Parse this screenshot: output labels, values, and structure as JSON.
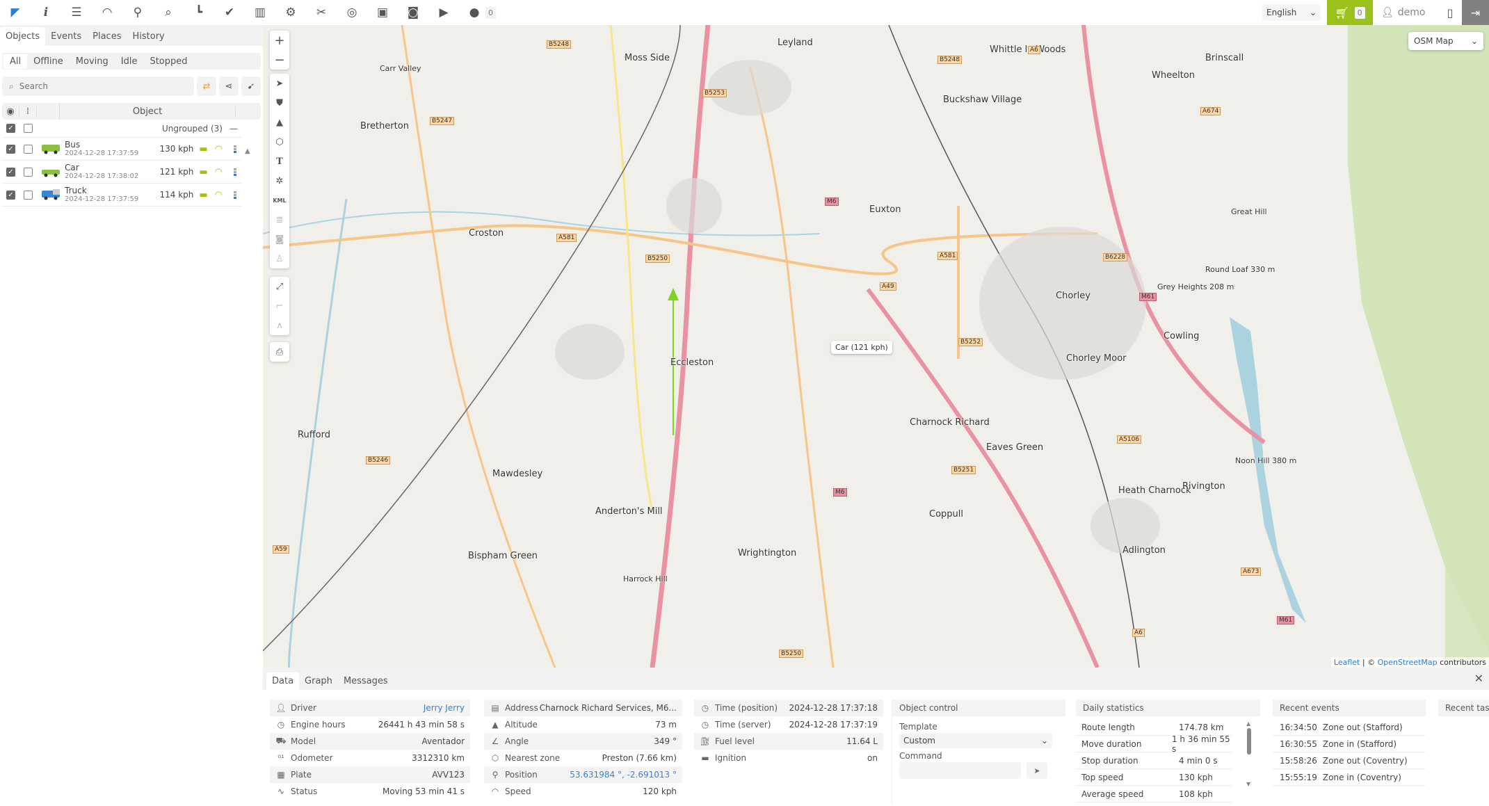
{
  "topbar": {
    "icons": [
      "logo-arrow-icon",
      "info-icon",
      "settings-sliders-icon",
      "dashboard-gauge-icon",
      "places-marker-icon",
      "search-icon",
      "reports-chart-icon",
      "tasks-check-icon",
      "rfid-book-icon",
      "maintenance-engine-icon",
      "tools-icon",
      "expenses-coins-icon",
      "object-control-icon",
      "image-gallery-camera-icon",
      "dashcam-video-icon",
      "chat-icon"
    ],
    "chat_count": "0",
    "language": "English",
    "cart_count": "0",
    "user": "demo",
    "accent": "#9dc11b"
  },
  "left": {
    "tabs": [
      "Objects",
      "Events",
      "Places",
      "History"
    ],
    "filters": [
      "All",
      "Offline",
      "Moving",
      "Idle",
      "Stopped"
    ],
    "search_placeholder": "Search",
    "column_object": "Object",
    "group_label": "Ungrouped (3)",
    "objects": [
      {
        "name": "Bus",
        "time": "2024-12-28 17:37:59",
        "speed": "130 kph",
        "color": "#8cbf3f",
        "type": "bus"
      },
      {
        "name": "Car",
        "time": "2024-12-28 17:38:02",
        "speed": "121 kph",
        "color": "#8cbf3f",
        "type": "car"
      },
      {
        "name": "Truck",
        "time": "2024-12-28 17:37:59",
        "speed": "114 kph",
        "color": "#3a86d0",
        "type": "truck"
      }
    ]
  },
  "map": {
    "type_select": "OSM Map",
    "tooltip": "Car (121 kph)",
    "attribution_leaflet": "Leaflet",
    "attribution_sep": " | © ",
    "attribution_osm": "OpenStreetMap",
    "attribution_rest": " contributors",
    "towns": [
      {
        "name": "Moss Side",
        "big": true
      },
      {
        "name": "Leyland",
        "big": true
      },
      {
        "name": "Whittle le Woods",
        "big": true
      },
      {
        "name": "Wheelton",
        "big": true
      },
      {
        "name": "Brinscall",
        "big": true
      },
      {
        "name": "Bretherton",
        "big": true
      },
      {
        "name": "Buckshaw Village",
        "big": true
      },
      {
        "name": "Croston",
        "big": true
      },
      {
        "name": "Euxton",
        "big": true
      },
      {
        "name": "Chorley",
        "big": true
      },
      {
        "name": "Cowling",
        "big": true
      },
      {
        "name": "Chorley Moor",
        "big": true
      },
      {
        "name": "Eccleston",
        "big": true
      },
      {
        "name": "Charnock Richard",
        "big": true
      },
      {
        "name": "Eaves Green",
        "big": true
      },
      {
        "name": "Rufford",
        "big": true
      },
      {
        "name": "Mawdesley",
        "big": true
      },
      {
        "name": "Heath Charnock",
        "big": true
      },
      {
        "name": "Rivington",
        "big": true
      },
      {
        "name": "Anderton's Mill",
        "big": true
      },
      {
        "name": "Coppull",
        "big": true
      },
      {
        "name": "Wrightington",
        "big": true
      },
      {
        "name": "Bispham Green",
        "big": true
      },
      {
        "name": "Adlington",
        "big": true
      },
      {
        "name": "Carr Valley",
        "big": false
      },
      {
        "name": "Grey Heights 208 m",
        "big": false
      },
      {
        "name": "Great Hill",
        "big": false
      },
      {
        "name": "Round Loaf 330 m",
        "big": false
      },
      {
        "name": "Noon Hill 380 m",
        "big": false
      },
      {
        "name": "Harrock Hill",
        "big": false
      }
    ],
    "roads": [
      "B5248",
      "B5253",
      "B5247",
      "A581",
      "B5250",
      "A49",
      "M6",
      "A581",
      "B6228",
      "M61",
      "B5252",
      "A5106",
      "B5251",
      "B5246",
      "M6",
      "A59",
      "A673",
      "A6",
      "B5250",
      "M61",
      "A6",
      "B5248",
      "A674"
    ]
  },
  "bottom": {
    "tabs": [
      "Data",
      "Graph",
      "Messages"
    ],
    "col1": [
      {
        "icon": "driver-icon",
        "label": "Driver",
        "value": "Jerry Jerry",
        "link": true
      },
      {
        "icon": "clock-icon",
        "label": "Engine hours",
        "value": "26441 h 43 min 58 s"
      },
      {
        "icon": "car-model-icon",
        "label": "Model",
        "value": "Aventador"
      },
      {
        "icon": "odometer-icon",
        "label": "Odometer",
        "value": "3312310 km"
      },
      {
        "icon": "plate-icon",
        "label": "Plate",
        "value": "AVV123"
      },
      {
        "icon": "status-pulse-icon",
        "label": "Status",
        "value": "Moving 53 min 41 s"
      }
    ],
    "col2": [
      {
        "icon": "address-icon",
        "label": "Address",
        "value": "Charnock Richard Services, M6..."
      },
      {
        "icon": "altitude-icon",
        "label": "Altitude",
        "value": "73 m"
      },
      {
        "icon": "angle-icon",
        "label": "Angle",
        "value": "349 °"
      },
      {
        "icon": "zone-icon",
        "label": "Nearest zone",
        "value": "Preston (7.66 km)"
      },
      {
        "icon": "position-marker-icon",
        "label": "Position",
        "value": "53.631984 °, -2.691013 °",
        "link": true
      },
      {
        "icon": "speed-icon",
        "label": "Speed",
        "value": "120 kph"
      }
    ],
    "col3": [
      {
        "icon": "clock-icon",
        "label": "Time (position)",
        "value": "2024-12-28 17:37:18"
      },
      {
        "icon": "clock-icon",
        "label": "Time (server)",
        "value": "2024-12-28 17:37:19"
      },
      {
        "icon": "fuel-icon",
        "label": "Fuel level",
        "value": "11.64 L"
      },
      {
        "icon": "ignition-engine-icon",
        "label": "Ignition",
        "value": "on"
      }
    ],
    "object_control": {
      "title": "Object control",
      "template_label": "Template",
      "template_value": "Custom",
      "command_label": "Command"
    },
    "daily": {
      "title": "Daily statistics",
      "rows": [
        {
          "k": "Route length",
          "v": "174.78 km"
        },
        {
          "k": "Move duration",
          "v": "1 h 36 min 55 s"
        },
        {
          "k": "Stop duration",
          "v": "4 min 0 s"
        },
        {
          "k": "Top speed",
          "v": "130 kph"
        },
        {
          "k": "Average speed",
          "v": "108 kph"
        }
      ]
    },
    "events": {
      "title": "Recent events",
      "rows": [
        {
          "t": "16:34:50",
          "e": "Zone out (Stafford)"
        },
        {
          "t": "16:30:55",
          "e": "Zone in (Stafford)"
        },
        {
          "t": "15:58:26",
          "e": "Zone out (Coventry)"
        },
        {
          "t": "15:55:19",
          "e": "Zone in (Coventry)"
        }
      ]
    },
    "tasks": {
      "title": "Recent tasks"
    }
  }
}
